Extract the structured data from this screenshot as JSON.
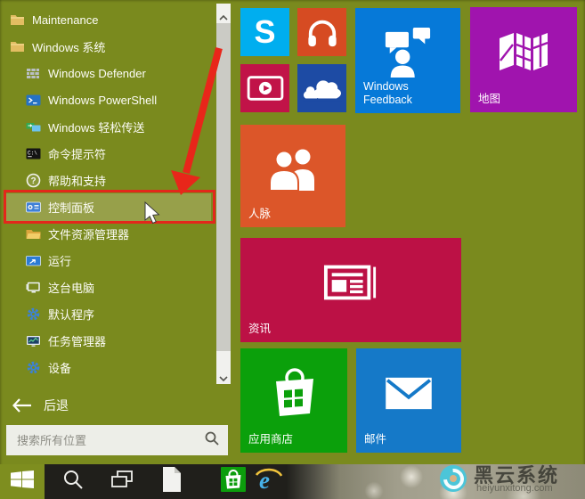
{
  "menu": {
    "items": [
      {
        "label": "Maintenance",
        "icon": "folder-icon"
      },
      {
        "label": "Windows 系统",
        "icon": "folder-icon"
      },
      {
        "label": "Windows Defender",
        "icon": "defender-icon"
      },
      {
        "label": "Windows PowerShell",
        "icon": "powershell-icon"
      },
      {
        "label": "Windows 轻松传送",
        "icon": "easy-transfer-icon"
      },
      {
        "label": "命令提示符",
        "icon": "command-prompt-icon"
      },
      {
        "label": "帮助和支持",
        "icon": "help-icon"
      },
      {
        "label": "控制面板",
        "icon": "control-panel-icon",
        "highlighted": true
      },
      {
        "label": "文件资源管理器",
        "icon": "file-explorer-icon"
      },
      {
        "label": "运行",
        "icon": "run-icon"
      },
      {
        "label": "这台电脑",
        "icon": "this-pc-icon"
      },
      {
        "label": "默认程序",
        "icon": "gear-icon"
      },
      {
        "label": "任务管理器",
        "icon": "task-manager-icon"
      },
      {
        "label": "设备",
        "icon": "gear-icon"
      }
    ],
    "back_label": "后退",
    "search_placeholder": "搜索所有位置"
  },
  "tiles": [
    {
      "id": "skype",
      "label": "",
      "color": "#00aeef"
    },
    {
      "id": "music",
      "label": "",
      "color": "#d64b22"
    },
    {
      "id": "windows-feedback",
      "label": "Windows Feedback",
      "color": "#0679d8"
    },
    {
      "id": "maps",
      "label": "地图",
      "color": "#a014ae"
    },
    {
      "id": "video",
      "label": "",
      "color": "#c11348"
    },
    {
      "id": "onedrive",
      "label": "",
      "color": "#1d4ba4"
    },
    {
      "id": "people",
      "label": "人脉",
      "color": "#dc5629"
    },
    {
      "id": "news",
      "label": "资讯",
      "color": "#bc1145"
    },
    {
      "id": "store",
      "label": "应用商店",
      "color": "#0ba00b"
    },
    {
      "id": "mail",
      "label": "邮件",
      "color": "#1579c8"
    }
  ],
  "taskbar": {
    "icons": [
      "start",
      "search",
      "task-view",
      "document",
      "store",
      "internet-explorer"
    ]
  },
  "watermark": {
    "title": "黑云系统",
    "subtitle": "heiyunxitong.com"
  },
  "colors": {
    "start_menu_bg": "#7a8a1e",
    "highlight_bg": "#97a04a",
    "annotation_red": "#e3271b",
    "taskbar_dark": "#201f1b",
    "scrollbar_track": "#f1f1ee",
    "scrollbar_thumb": "#cbcbc5",
    "search_box_bg": "#edeee8"
  }
}
